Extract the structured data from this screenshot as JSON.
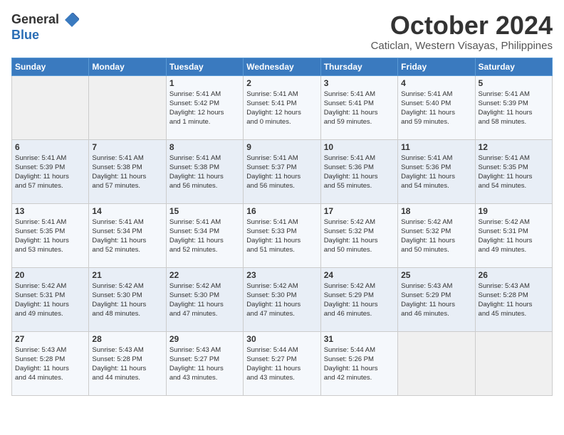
{
  "header": {
    "logo": {
      "line1": "General",
      "line2": "Blue"
    },
    "month": "October 2024",
    "location": "Caticlan, Western Visayas, Philippines"
  },
  "weekdays": [
    "Sunday",
    "Monday",
    "Tuesday",
    "Wednesday",
    "Thursday",
    "Friday",
    "Saturday"
  ],
  "weeks": [
    [
      {
        "day": "",
        "info": ""
      },
      {
        "day": "",
        "info": ""
      },
      {
        "day": "1",
        "info": "Sunrise: 5:41 AM\nSunset: 5:42 PM\nDaylight: 12 hours\nand 1 minute."
      },
      {
        "day": "2",
        "info": "Sunrise: 5:41 AM\nSunset: 5:41 PM\nDaylight: 12 hours\nand 0 minutes."
      },
      {
        "day": "3",
        "info": "Sunrise: 5:41 AM\nSunset: 5:41 PM\nDaylight: 11 hours\nand 59 minutes."
      },
      {
        "day": "4",
        "info": "Sunrise: 5:41 AM\nSunset: 5:40 PM\nDaylight: 11 hours\nand 59 minutes."
      },
      {
        "day": "5",
        "info": "Sunrise: 5:41 AM\nSunset: 5:39 PM\nDaylight: 11 hours\nand 58 minutes."
      }
    ],
    [
      {
        "day": "6",
        "info": "Sunrise: 5:41 AM\nSunset: 5:39 PM\nDaylight: 11 hours\nand 57 minutes."
      },
      {
        "day": "7",
        "info": "Sunrise: 5:41 AM\nSunset: 5:38 PM\nDaylight: 11 hours\nand 57 minutes."
      },
      {
        "day": "8",
        "info": "Sunrise: 5:41 AM\nSunset: 5:38 PM\nDaylight: 11 hours\nand 56 minutes."
      },
      {
        "day": "9",
        "info": "Sunrise: 5:41 AM\nSunset: 5:37 PM\nDaylight: 11 hours\nand 56 minutes."
      },
      {
        "day": "10",
        "info": "Sunrise: 5:41 AM\nSunset: 5:36 PM\nDaylight: 11 hours\nand 55 minutes."
      },
      {
        "day": "11",
        "info": "Sunrise: 5:41 AM\nSunset: 5:36 PM\nDaylight: 11 hours\nand 54 minutes."
      },
      {
        "day": "12",
        "info": "Sunrise: 5:41 AM\nSunset: 5:35 PM\nDaylight: 11 hours\nand 54 minutes."
      }
    ],
    [
      {
        "day": "13",
        "info": "Sunrise: 5:41 AM\nSunset: 5:35 PM\nDaylight: 11 hours\nand 53 minutes."
      },
      {
        "day": "14",
        "info": "Sunrise: 5:41 AM\nSunset: 5:34 PM\nDaylight: 11 hours\nand 52 minutes."
      },
      {
        "day": "15",
        "info": "Sunrise: 5:41 AM\nSunset: 5:34 PM\nDaylight: 11 hours\nand 52 minutes."
      },
      {
        "day": "16",
        "info": "Sunrise: 5:41 AM\nSunset: 5:33 PM\nDaylight: 11 hours\nand 51 minutes."
      },
      {
        "day": "17",
        "info": "Sunrise: 5:42 AM\nSunset: 5:32 PM\nDaylight: 11 hours\nand 50 minutes."
      },
      {
        "day": "18",
        "info": "Sunrise: 5:42 AM\nSunset: 5:32 PM\nDaylight: 11 hours\nand 50 minutes."
      },
      {
        "day": "19",
        "info": "Sunrise: 5:42 AM\nSunset: 5:31 PM\nDaylight: 11 hours\nand 49 minutes."
      }
    ],
    [
      {
        "day": "20",
        "info": "Sunrise: 5:42 AM\nSunset: 5:31 PM\nDaylight: 11 hours\nand 49 minutes."
      },
      {
        "day": "21",
        "info": "Sunrise: 5:42 AM\nSunset: 5:30 PM\nDaylight: 11 hours\nand 48 minutes."
      },
      {
        "day": "22",
        "info": "Sunrise: 5:42 AM\nSunset: 5:30 PM\nDaylight: 11 hours\nand 47 minutes."
      },
      {
        "day": "23",
        "info": "Sunrise: 5:42 AM\nSunset: 5:30 PM\nDaylight: 11 hours\nand 47 minutes."
      },
      {
        "day": "24",
        "info": "Sunrise: 5:42 AM\nSunset: 5:29 PM\nDaylight: 11 hours\nand 46 minutes."
      },
      {
        "day": "25",
        "info": "Sunrise: 5:43 AM\nSunset: 5:29 PM\nDaylight: 11 hours\nand 46 minutes."
      },
      {
        "day": "26",
        "info": "Sunrise: 5:43 AM\nSunset: 5:28 PM\nDaylight: 11 hours\nand 45 minutes."
      }
    ],
    [
      {
        "day": "27",
        "info": "Sunrise: 5:43 AM\nSunset: 5:28 PM\nDaylight: 11 hours\nand 44 minutes."
      },
      {
        "day": "28",
        "info": "Sunrise: 5:43 AM\nSunset: 5:28 PM\nDaylight: 11 hours\nand 44 minutes."
      },
      {
        "day": "29",
        "info": "Sunrise: 5:43 AM\nSunset: 5:27 PM\nDaylight: 11 hours\nand 43 minutes."
      },
      {
        "day": "30",
        "info": "Sunrise: 5:44 AM\nSunset: 5:27 PM\nDaylight: 11 hours\nand 43 minutes."
      },
      {
        "day": "31",
        "info": "Sunrise: 5:44 AM\nSunset: 5:26 PM\nDaylight: 11 hours\nand 42 minutes."
      },
      {
        "day": "",
        "info": ""
      },
      {
        "day": "",
        "info": ""
      }
    ]
  ]
}
